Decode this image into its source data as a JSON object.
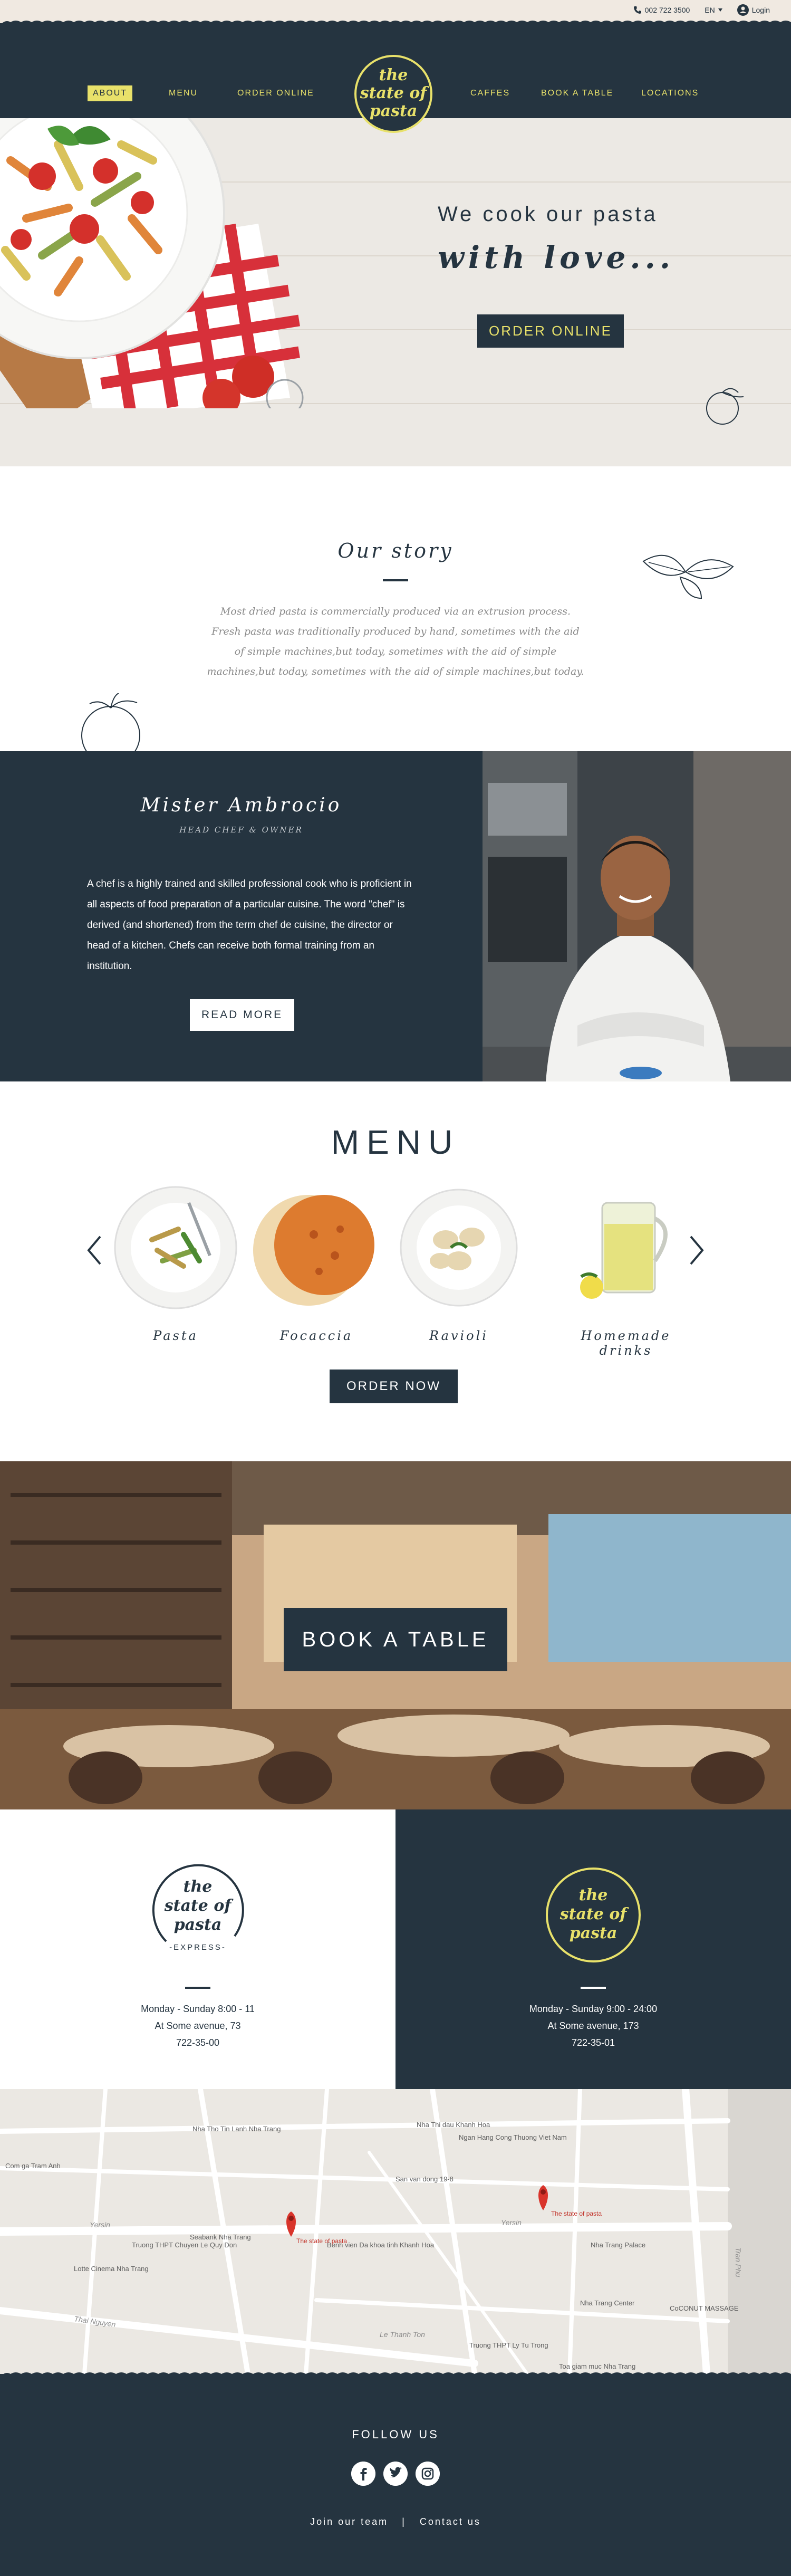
{
  "topbar": {
    "phone": "002 722 3500",
    "language": "EN",
    "login_label": "Login"
  },
  "nav": {
    "left": [
      "About",
      "Menu",
      "Order online"
    ],
    "right": [
      "Caffes",
      "Book a table",
      "Locations"
    ],
    "active": "About",
    "logo_lines": [
      "the",
      "state of",
      "pasta"
    ]
  },
  "hero": {
    "subtitle": "We cook our pasta",
    "title": "with love...",
    "cta_label": "ORDER ONLINE"
  },
  "story": {
    "title": "Our story",
    "text": "Most dried pasta is commercially produced via an extrusion process. Fresh pasta was traditionally produced by hand, sometimes with the aid of simple machines,but today, sometimes with the aid of simple machines,but today, sometimes with the aid of simple machines,but today."
  },
  "chef": {
    "name": "Mister Ambrocio",
    "role": "Head chef & owner",
    "bio": "A chef is a highly trained and skilled professional cook who is proficient in all aspects of food preparation of a particular cuisine. The word \"chef\" is derived (and shortened) from the term chef de cuisine, the director or head of a kitchen. Chefs can receive both formal training from an institution.",
    "cta_label": "Read more"
  },
  "menu": {
    "title": "MENU",
    "items": [
      {
        "name": "Pasta",
        "icon": "pasta-plate"
      },
      {
        "name": "Focaccia",
        "icon": "focaccia-bread"
      },
      {
        "name": "Ravioli",
        "icon": "ravioli-plate"
      },
      {
        "name": "Homemade drinks",
        "icon": "lemonade-jug"
      }
    ],
    "cta_label": "ORDER NOW"
  },
  "booking": {
    "cta_label": "BOOK A TABLE"
  },
  "locations": [
    {
      "logo_lines": [
        "the",
        "state of",
        "pasta"
      ],
      "logo_tagline": "-EXPRESS-",
      "hours": "Monday - Sunday 8:00 - 11",
      "address": "At Some avenue, 73",
      "phone": "722-35-00"
    },
    {
      "logo_lines": [
        "the",
        "state of",
        "pasta"
      ],
      "hours": "Monday - Sunday 9:00 - 24:00",
      "address": "At Some avenue, 173",
      "phone": "722-35-01"
    }
  ],
  "map": {
    "labels": [
      "Nha Tho Tin Lanh Nha Trang",
      "Nha Thi dau Khanh Hoa",
      "Ngan Hang Cong Thuong Viet Nam",
      "Com ga Tram Anh",
      "San van dong 19-8",
      "Seabank Nha Trang",
      "Truong THPT Chuyen Le Quy Don",
      "Lotte Cinema Nha Trang",
      "Benh vien Da khoa tinh Khanh Hoa",
      "Nha Trang Palace",
      "Nha Trang Center",
      "Truong THPT Ly Tu Trong",
      "CoCONUT MASSAGE",
      "Toa giam muc Nha Trang"
    ],
    "street_labels": [
      "Yersin",
      "Yersin",
      "Thai Nguyen",
      "Tran Phu",
      "Le Thanh Ton"
    ],
    "pin_labels": [
      "The state of pasta",
      "The state of pasta"
    ],
    "pin_color": "#d9342b"
  },
  "footer": {
    "follow": "FOLLOW US",
    "social": [
      "facebook-icon",
      "twitter-icon",
      "instagram-icon"
    ],
    "links": [
      "Join our team",
      "Contact us"
    ],
    "separator": "|"
  },
  "colors": {
    "navy": "#253440",
    "accent": "#e8e16a",
    "cream": "#f0e9e1"
  }
}
